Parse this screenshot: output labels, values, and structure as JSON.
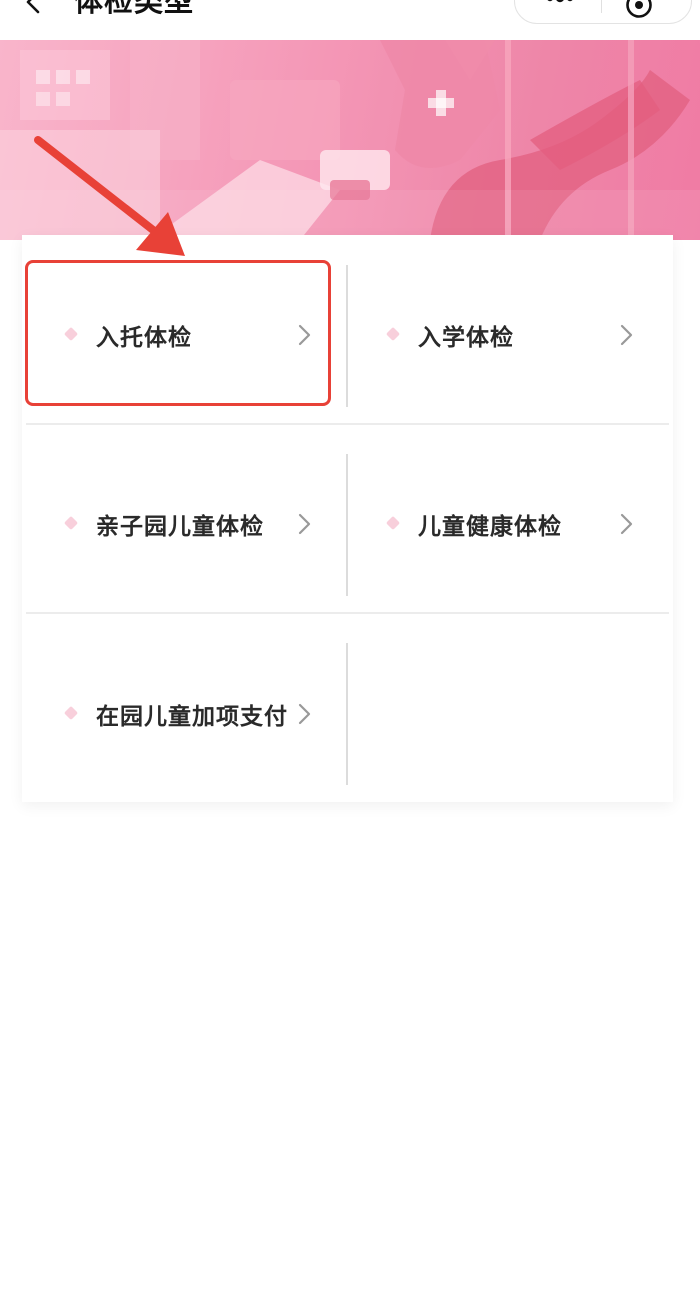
{
  "nav": {
    "title": "体检类型",
    "back_icon": "back-chevron-icon",
    "more_icon": "more-dots-icon",
    "close_icon": "close-circle-icon"
  },
  "banner": {
    "theme_colors": [
      "#f9b5cb",
      "#f497b6",
      "#ee86a8"
    ]
  },
  "exam_types": [
    {
      "label": "入托体检",
      "icon": "diamond-bullet-icon",
      "highlighted": true
    },
    {
      "label": "入学体检",
      "icon": "diamond-bullet-icon",
      "highlighted": false
    },
    {
      "label": "亲子园儿童体检",
      "icon": "diamond-bullet-icon",
      "highlighted": false
    },
    {
      "label": "儿童健康体检",
      "icon": "diamond-bullet-icon",
      "highlighted": false
    },
    {
      "label": "在园儿童加项支付",
      "icon": "diamond-bullet-icon",
      "highlighted": false
    }
  ],
  "annotation": {
    "color": "#e84137"
  },
  "colors": {
    "accent_pink": "#f8cfdb",
    "annotation_red": "#e84137",
    "text_dark": "#2a2a2a",
    "chevron_gray": "#999999"
  }
}
